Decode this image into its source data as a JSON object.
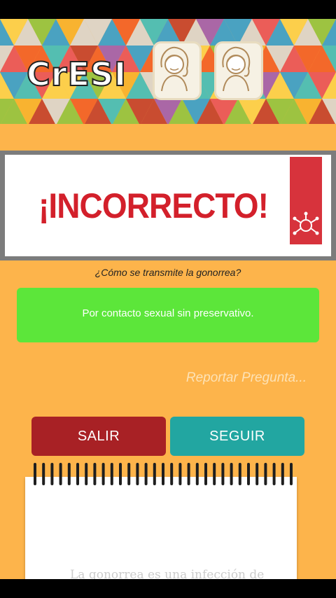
{
  "app": {
    "logo_text": "CrESI",
    "header_colors": [
      "#e84d5b",
      "#f7b32b",
      "#36c0c3",
      "#2a9fd6",
      "#8cc63f",
      "#f15a24",
      "#9b59b6",
      "#fbd44b",
      "#d9d9d9",
      "#c0392b"
    ]
  },
  "result": {
    "title": "¡INCORRECTO!",
    "title_color": "#d3202b"
  },
  "question": {
    "text": "¿Cómo se transmite la gonorrea?"
  },
  "answer": {
    "text": "Por contacto sexual sin preservativo.",
    "color": "#5ce63a"
  },
  "report": {
    "label": "Reportar Pregunta..."
  },
  "buttons": {
    "exit_label": "SALIR",
    "next_label": "SEGUIR"
  },
  "notebook": {
    "peek_text": "La gonorrea es una infección de"
  }
}
